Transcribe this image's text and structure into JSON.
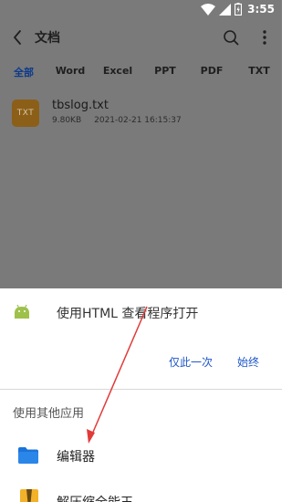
{
  "status_bar": {
    "time": "3:55",
    "icons": [
      "wifi-icon",
      "signal-icon",
      "battery-icon"
    ]
  },
  "app": {
    "title": "文档",
    "icons": [
      "back-icon",
      "search-icon",
      "more-icon"
    ],
    "tabs": [
      "全部",
      "Word",
      "Excel",
      "PPT",
      "PDF",
      "TXT"
    ],
    "active_tab": "全部",
    "files": [
      {
        "icon_label": "TXT",
        "name": "tbslog.txt",
        "size": "9.80KB",
        "date": "2021-02-21 16:15:37"
      }
    ]
  },
  "sheet": {
    "open_with": "使用HTML 查看程序打开",
    "buttons": {
      "once": "仅此一次",
      "always": "始终"
    },
    "other_apps_title": "使用其他应用",
    "apps": [
      {
        "label": "编辑器",
        "icon": "folder-icon"
      },
      {
        "label": "解压缩全能王",
        "icon": "zip-icon"
      }
    ]
  },
  "colors": {
    "dim_overlay": "#7a7a7a",
    "accent_blue": "#1e56c8",
    "active_tab": "#0e3a8a",
    "file_icon": "#8b5f18",
    "folder_blue": "#1a73d9",
    "android_green": "#9ec14a",
    "annotation_red": "#e23a3a"
  }
}
